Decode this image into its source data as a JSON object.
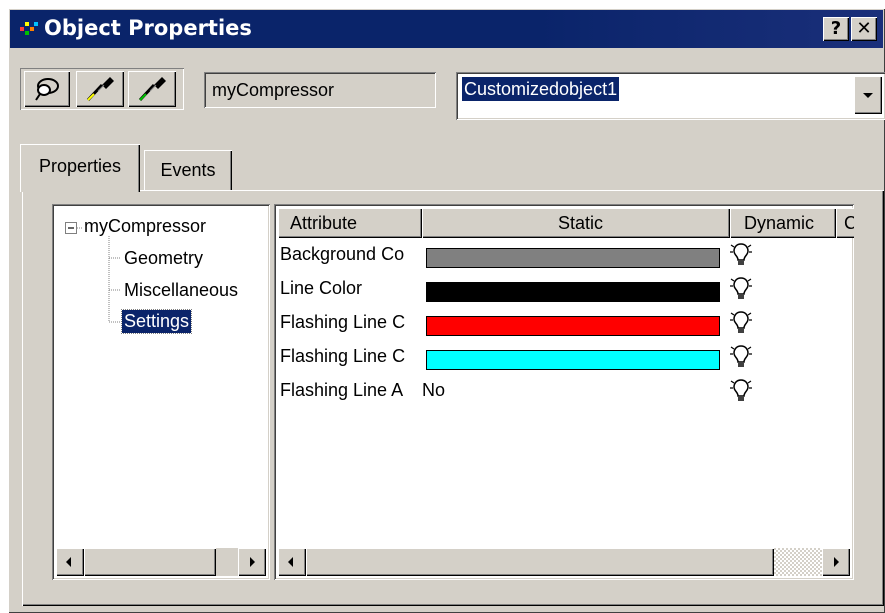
{
  "window": {
    "title": "Object Properties",
    "help_button": "?",
    "close_button": "✕"
  },
  "toolbar": {
    "object_name": "myCompressor",
    "combo_value": "Customizedobject1"
  },
  "tabs": [
    {
      "label": "Properties",
      "active": true
    },
    {
      "label": "Events",
      "active": false
    }
  ],
  "tree": {
    "root": "myCompressor",
    "expander": "−",
    "children": [
      "Geometry",
      "Miscellaneous",
      "Settings"
    ],
    "selected": "Settings"
  },
  "grid": {
    "columns": [
      "Attribute",
      "Static",
      "Dynamic",
      "C"
    ],
    "rows": [
      {
        "attribute": "Background Co",
        "static_color": "#808080",
        "static_text": ""
      },
      {
        "attribute": "Line Color",
        "static_color": "#000000",
        "static_text": ""
      },
      {
        "attribute": "Flashing Line C",
        "static_color": "#ff0000",
        "static_text": ""
      },
      {
        "attribute": "Flashing Line C",
        "static_color": "#00ffff",
        "static_text": ""
      },
      {
        "attribute": "Flashing Line A",
        "static_color": "",
        "static_text": "No"
      }
    ]
  },
  "colors": {
    "titlebar": "#0a246a",
    "face": "#d4d0c8",
    "selection": "#0a246a"
  },
  "icons": [
    "app-icon",
    "lasso-icon",
    "pipette-icon",
    "pipette-icon",
    "lightbulb-icon",
    "chevron-down-icon",
    "arrow-left-icon",
    "arrow-right-icon"
  ]
}
